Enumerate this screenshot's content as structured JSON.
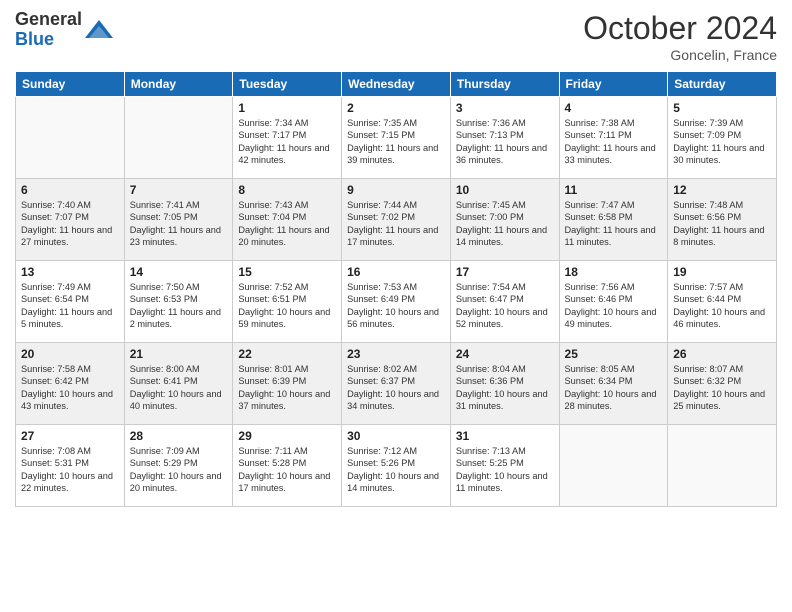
{
  "logo": {
    "general": "General",
    "blue": "Blue"
  },
  "title": "October 2024",
  "subtitle": "Goncelin, France",
  "days": [
    "Sunday",
    "Monday",
    "Tuesday",
    "Wednesday",
    "Thursday",
    "Friday",
    "Saturday"
  ],
  "weeks": [
    [
      {
        "day": "",
        "content": ""
      },
      {
        "day": "",
        "content": ""
      },
      {
        "day": "1",
        "content": "Sunrise: 7:34 AM\nSunset: 7:17 PM\nDaylight: 11 hours and 42 minutes."
      },
      {
        "day": "2",
        "content": "Sunrise: 7:35 AM\nSunset: 7:15 PM\nDaylight: 11 hours and 39 minutes."
      },
      {
        "day": "3",
        "content": "Sunrise: 7:36 AM\nSunset: 7:13 PM\nDaylight: 11 hours and 36 minutes."
      },
      {
        "day": "4",
        "content": "Sunrise: 7:38 AM\nSunset: 7:11 PM\nDaylight: 11 hours and 33 minutes."
      },
      {
        "day": "5",
        "content": "Sunrise: 7:39 AM\nSunset: 7:09 PM\nDaylight: 11 hours and 30 minutes."
      }
    ],
    [
      {
        "day": "6",
        "content": "Sunrise: 7:40 AM\nSunset: 7:07 PM\nDaylight: 11 hours and 27 minutes."
      },
      {
        "day": "7",
        "content": "Sunrise: 7:41 AM\nSunset: 7:05 PM\nDaylight: 11 hours and 23 minutes."
      },
      {
        "day": "8",
        "content": "Sunrise: 7:43 AM\nSunset: 7:04 PM\nDaylight: 11 hours and 20 minutes."
      },
      {
        "day": "9",
        "content": "Sunrise: 7:44 AM\nSunset: 7:02 PM\nDaylight: 11 hours and 17 minutes."
      },
      {
        "day": "10",
        "content": "Sunrise: 7:45 AM\nSunset: 7:00 PM\nDaylight: 11 hours and 14 minutes."
      },
      {
        "day": "11",
        "content": "Sunrise: 7:47 AM\nSunset: 6:58 PM\nDaylight: 11 hours and 11 minutes."
      },
      {
        "day": "12",
        "content": "Sunrise: 7:48 AM\nSunset: 6:56 PM\nDaylight: 11 hours and 8 minutes."
      }
    ],
    [
      {
        "day": "13",
        "content": "Sunrise: 7:49 AM\nSunset: 6:54 PM\nDaylight: 11 hours and 5 minutes."
      },
      {
        "day": "14",
        "content": "Sunrise: 7:50 AM\nSunset: 6:53 PM\nDaylight: 11 hours and 2 minutes."
      },
      {
        "day": "15",
        "content": "Sunrise: 7:52 AM\nSunset: 6:51 PM\nDaylight: 10 hours and 59 minutes."
      },
      {
        "day": "16",
        "content": "Sunrise: 7:53 AM\nSunset: 6:49 PM\nDaylight: 10 hours and 56 minutes."
      },
      {
        "day": "17",
        "content": "Sunrise: 7:54 AM\nSunset: 6:47 PM\nDaylight: 10 hours and 52 minutes."
      },
      {
        "day": "18",
        "content": "Sunrise: 7:56 AM\nSunset: 6:46 PM\nDaylight: 10 hours and 49 minutes."
      },
      {
        "day": "19",
        "content": "Sunrise: 7:57 AM\nSunset: 6:44 PM\nDaylight: 10 hours and 46 minutes."
      }
    ],
    [
      {
        "day": "20",
        "content": "Sunrise: 7:58 AM\nSunset: 6:42 PM\nDaylight: 10 hours and 43 minutes."
      },
      {
        "day": "21",
        "content": "Sunrise: 8:00 AM\nSunset: 6:41 PM\nDaylight: 10 hours and 40 minutes."
      },
      {
        "day": "22",
        "content": "Sunrise: 8:01 AM\nSunset: 6:39 PM\nDaylight: 10 hours and 37 minutes."
      },
      {
        "day": "23",
        "content": "Sunrise: 8:02 AM\nSunset: 6:37 PM\nDaylight: 10 hours and 34 minutes."
      },
      {
        "day": "24",
        "content": "Sunrise: 8:04 AM\nSunset: 6:36 PM\nDaylight: 10 hours and 31 minutes."
      },
      {
        "day": "25",
        "content": "Sunrise: 8:05 AM\nSunset: 6:34 PM\nDaylight: 10 hours and 28 minutes."
      },
      {
        "day": "26",
        "content": "Sunrise: 8:07 AM\nSunset: 6:32 PM\nDaylight: 10 hours and 25 minutes."
      }
    ],
    [
      {
        "day": "27",
        "content": "Sunrise: 7:08 AM\nSunset: 5:31 PM\nDaylight: 10 hours and 22 minutes."
      },
      {
        "day": "28",
        "content": "Sunrise: 7:09 AM\nSunset: 5:29 PM\nDaylight: 10 hours and 20 minutes."
      },
      {
        "day": "29",
        "content": "Sunrise: 7:11 AM\nSunset: 5:28 PM\nDaylight: 10 hours and 17 minutes."
      },
      {
        "day": "30",
        "content": "Sunrise: 7:12 AM\nSunset: 5:26 PM\nDaylight: 10 hours and 14 minutes."
      },
      {
        "day": "31",
        "content": "Sunrise: 7:13 AM\nSunset: 5:25 PM\nDaylight: 10 hours and 11 minutes."
      },
      {
        "day": "",
        "content": ""
      },
      {
        "day": "",
        "content": ""
      }
    ]
  ]
}
